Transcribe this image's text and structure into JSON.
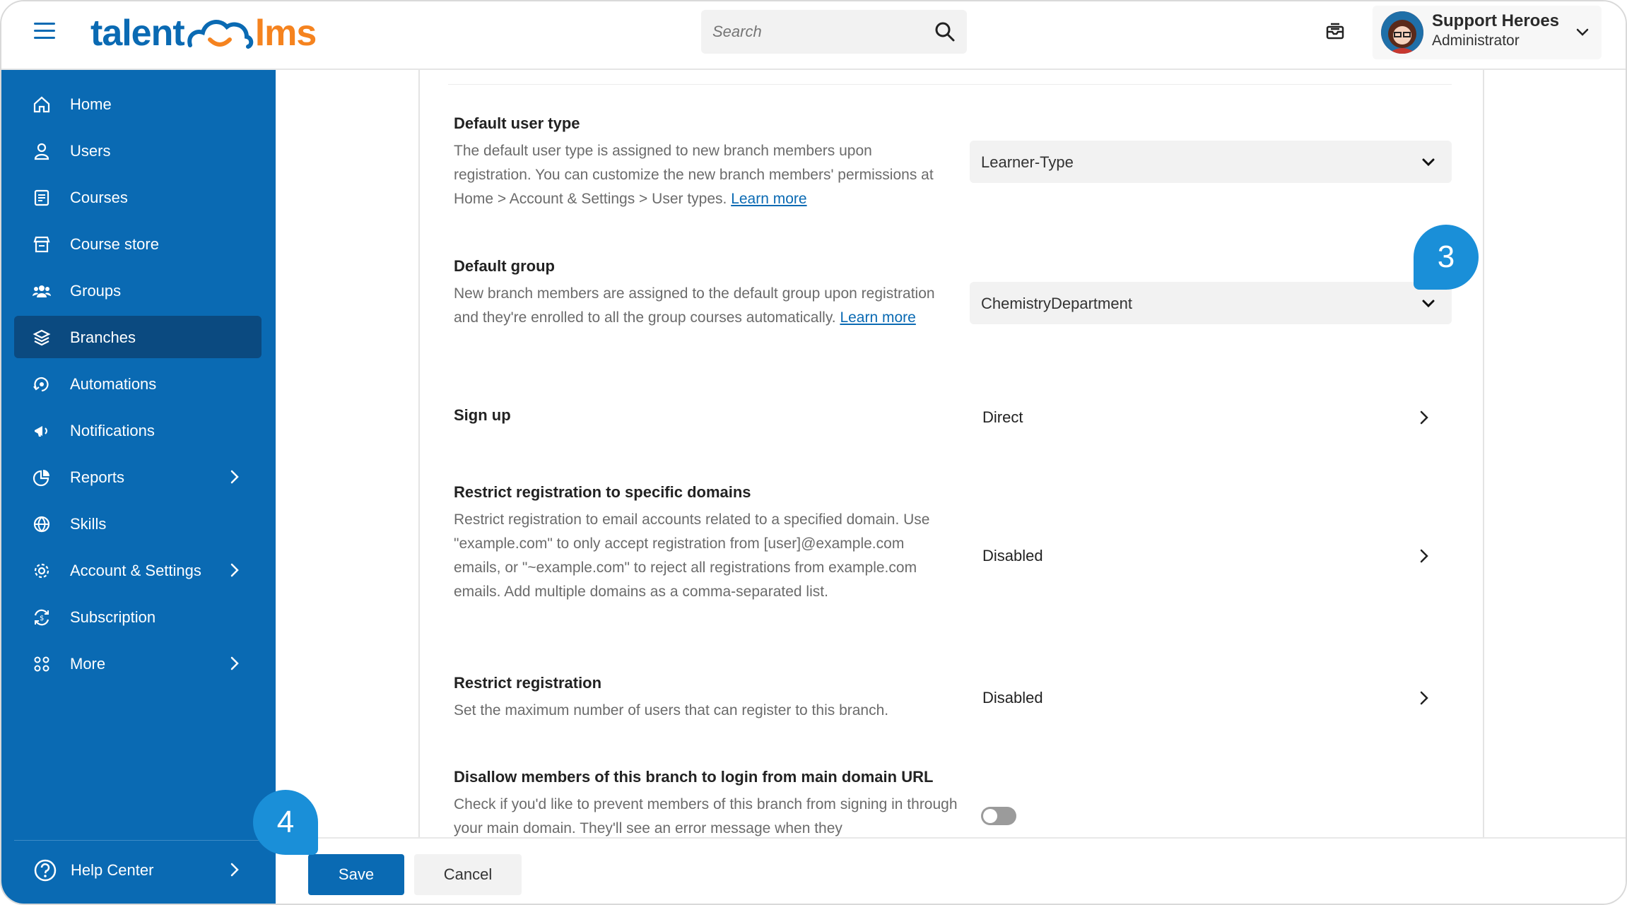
{
  "header": {
    "logo_part1": "talent",
    "logo_part2": "lms",
    "search_placeholder": "Search",
    "user_name": "Support Heroes",
    "user_role": "Administrator"
  },
  "sidebar": {
    "items": [
      {
        "label": "Home",
        "icon": "home-icon"
      },
      {
        "label": "Users",
        "icon": "user-icon"
      },
      {
        "label": "Courses",
        "icon": "courses-icon"
      },
      {
        "label": "Course store",
        "icon": "store-icon"
      },
      {
        "label": "Groups",
        "icon": "groups-icon"
      },
      {
        "label": "Branches",
        "icon": "branches-icon",
        "active": true
      },
      {
        "label": "Automations",
        "icon": "automations-icon"
      },
      {
        "label": "Notifications",
        "icon": "notifications-icon"
      },
      {
        "label": "Reports",
        "icon": "reports-icon",
        "has_submenu": true
      },
      {
        "label": "Skills",
        "icon": "skills-icon"
      },
      {
        "label": "Account & Settings",
        "icon": "settings-icon",
        "has_submenu": true
      },
      {
        "label": "Subscription",
        "icon": "subscription-icon"
      },
      {
        "label": "More",
        "icon": "more-icon",
        "has_submenu": true
      }
    ],
    "help_label": "Help Center"
  },
  "settings": {
    "default_user_type": {
      "title": "Default user type",
      "desc_pre": "The default user type is assigned to new branch members upon registration. You can customize the new branch members' permissions at Home > Account & Settings > User types. ",
      "link": "Learn more",
      "value": "Learner-Type"
    },
    "default_group": {
      "title": "Default group",
      "desc_pre": "New branch members are assigned to the default group upon registration and they're enrolled to all the group courses automatically. ",
      "link": "Learn more",
      "value": "ChemistryDepartment"
    },
    "sign_up": {
      "title": "Sign up",
      "value": "Direct"
    },
    "restrict_domains": {
      "title": "Restrict registration to specific domains",
      "desc": "Restrict registration to email accounts related to a specified domain. Use \"example.com\" to only accept registration from [user]@example.com emails, or \"~example.com\" to reject all registrations from example.com emails. Add multiple domains as a comma-separated list.",
      "value": "Disabled"
    },
    "restrict_registration": {
      "title": "Restrict registration",
      "desc": "Set the maximum number of users that can register to this branch.",
      "value": "Disabled"
    },
    "disallow_login": {
      "title": "Disallow members of this branch to login from main domain URL",
      "desc": "Check if you'd like to prevent members of this branch from signing in through your main domain. They'll see an error message when they",
      "enabled": false
    }
  },
  "actions": {
    "save_label": "Save",
    "cancel_label": "Cancel"
  },
  "callouts": {
    "step3": "3",
    "step4": "4"
  },
  "colors": {
    "brand_blue": "#0a6ab3",
    "brand_orange": "#f5831f",
    "active_nav": "#0b4a80",
    "callout": "#1a8fd8"
  }
}
